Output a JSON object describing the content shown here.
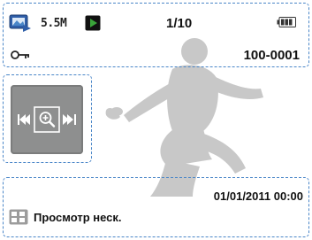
{
  "header": {
    "file_counter": "1/10",
    "resolution_label": "5.5M",
    "file_number": "100-0001"
  },
  "footer": {
    "datetime": "01/01/2011 00:00",
    "mode_label": "Просмотр неск."
  },
  "icons": {
    "gallery": "photo-playback-icon",
    "resolution": "resolution-icon",
    "play": "play-mode-icon",
    "battery": "battery-icon",
    "protect": "key-protect-icon",
    "nav": "prev-zoom-next-control",
    "multiview": "multi-view-icon"
  },
  "colors": {
    "dash_border": "#4a86c8",
    "control_bg": "#8e8f8f",
    "silhouette": "#c8c8c8",
    "play_green": "#3aa53a"
  }
}
